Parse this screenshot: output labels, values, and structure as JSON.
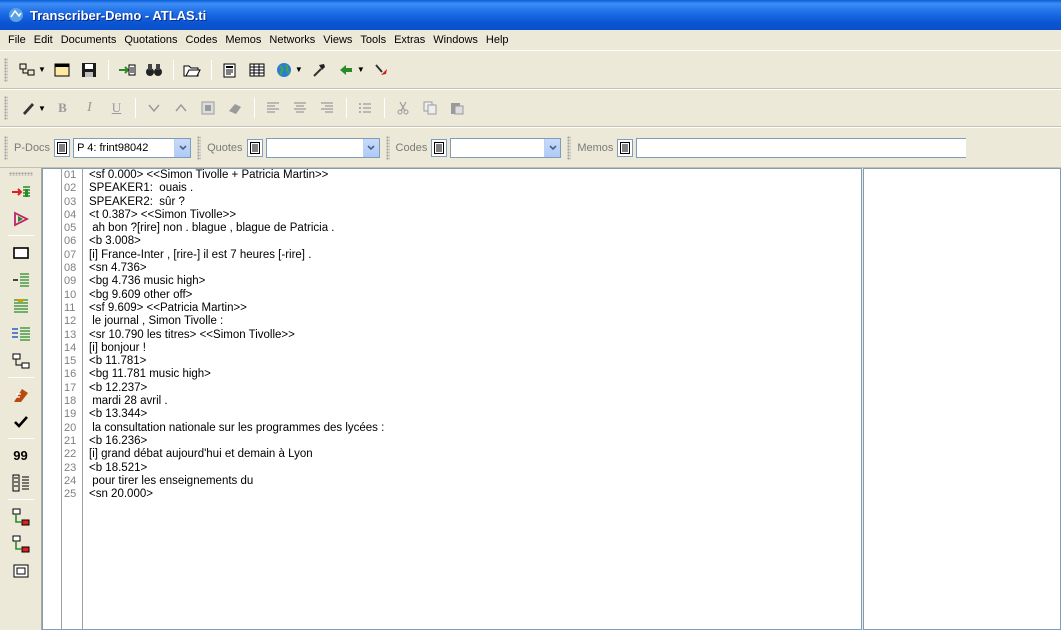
{
  "window": {
    "title": "Transcriber-Demo - ATLAS.ti"
  },
  "menu": [
    "File",
    "Edit",
    "Documents",
    "Quotations",
    "Codes",
    "Memos",
    "Networks",
    "Views",
    "Tools",
    "Extras",
    "Windows",
    "Help"
  ],
  "selectors": {
    "pdocs_label": "P-Docs",
    "pdocs_value": "P 4: frint98042",
    "quotes_label": "Quotes",
    "quotes_value": "",
    "codes_label": "Codes",
    "codes_value": "",
    "memos_label": "Memos",
    "memos_value": ""
  },
  "vtoolbar": {
    "quote_count_label": "99"
  },
  "document": {
    "lines": [
      {
        "n": "01",
        "text": "<sf 0.000> <<Simon Tivolle + Patricia Martin>>"
      },
      {
        "n": "02",
        "text": "SPEAKER1:  ouais ."
      },
      {
        "n": "03",
        "text": "SPEAKER2:  sûr ?"
      },
      {
        "n": "04",
        "text": "<t 0.387> <<Simon Tivolle>>"
      },
      {
        "n": "05",
        "text": " ah bon ?[rire] non . blague , blague de Patricia ."
      },
      {
        "n": "06",
        "text": "<b 3.008>"
      },
      {
        "n": "07",
        "text": "[i] France-Inter , [rire-] il est 7 heures [-rire] ."
      },
      {
        "n": "08",
        "text": "<sn 4.736>"
      },
      {
        "n": "09",
        "text": "<bg 4.736 music high>"
      },
      {
        "n": "10",
        "text": "<bg 9.609 other off>"
      },
      {
        "n": "11",
        "text": "<sf 9.609> <<Patricia Martin>>"
      },
      {
        "n": "12",
        "text": " le journal , Simon Tivolle :"
      },
      {
        "n": "13",
        "text": "<sr 10.790 les titres> <<Simon Tivolle>>"
      },
      {
        "n": "14",
        "text": "[i] bonjour !"
      },
      {
        "n": "15",
        "text": "<b 11.781>"
      },
      {
        "n": "16",
        "text": "<bg 11.781 music high>"
      },
      {
        "n": "17",
        "text": "<b 12.237>"
      },
      {
        "n": "18",
        "text": " mardi 28 avril ."
      },
      {
        "n": "19",
        "text": "<b 13.344>"
      },
      {
        "n": "20",
        "text": " la consultation nationale sur les programmes des lycées :"
      },
      {
        "n": "21",
        "text": "<b 16.236>"
      },
      {
        "n": "22",
        "text": "[i] grand débat aujourd'hui et demain à Lyon"
      },
      {
        "n": "23",
        "text": "<b 18.521>"
      },
      {
        "n": "24",
        "text": " pour tirer les enseignements du"
      },
      {
        "n": "25",
        "text": "<sn 20.000>"
      }
    ]
  }
}
